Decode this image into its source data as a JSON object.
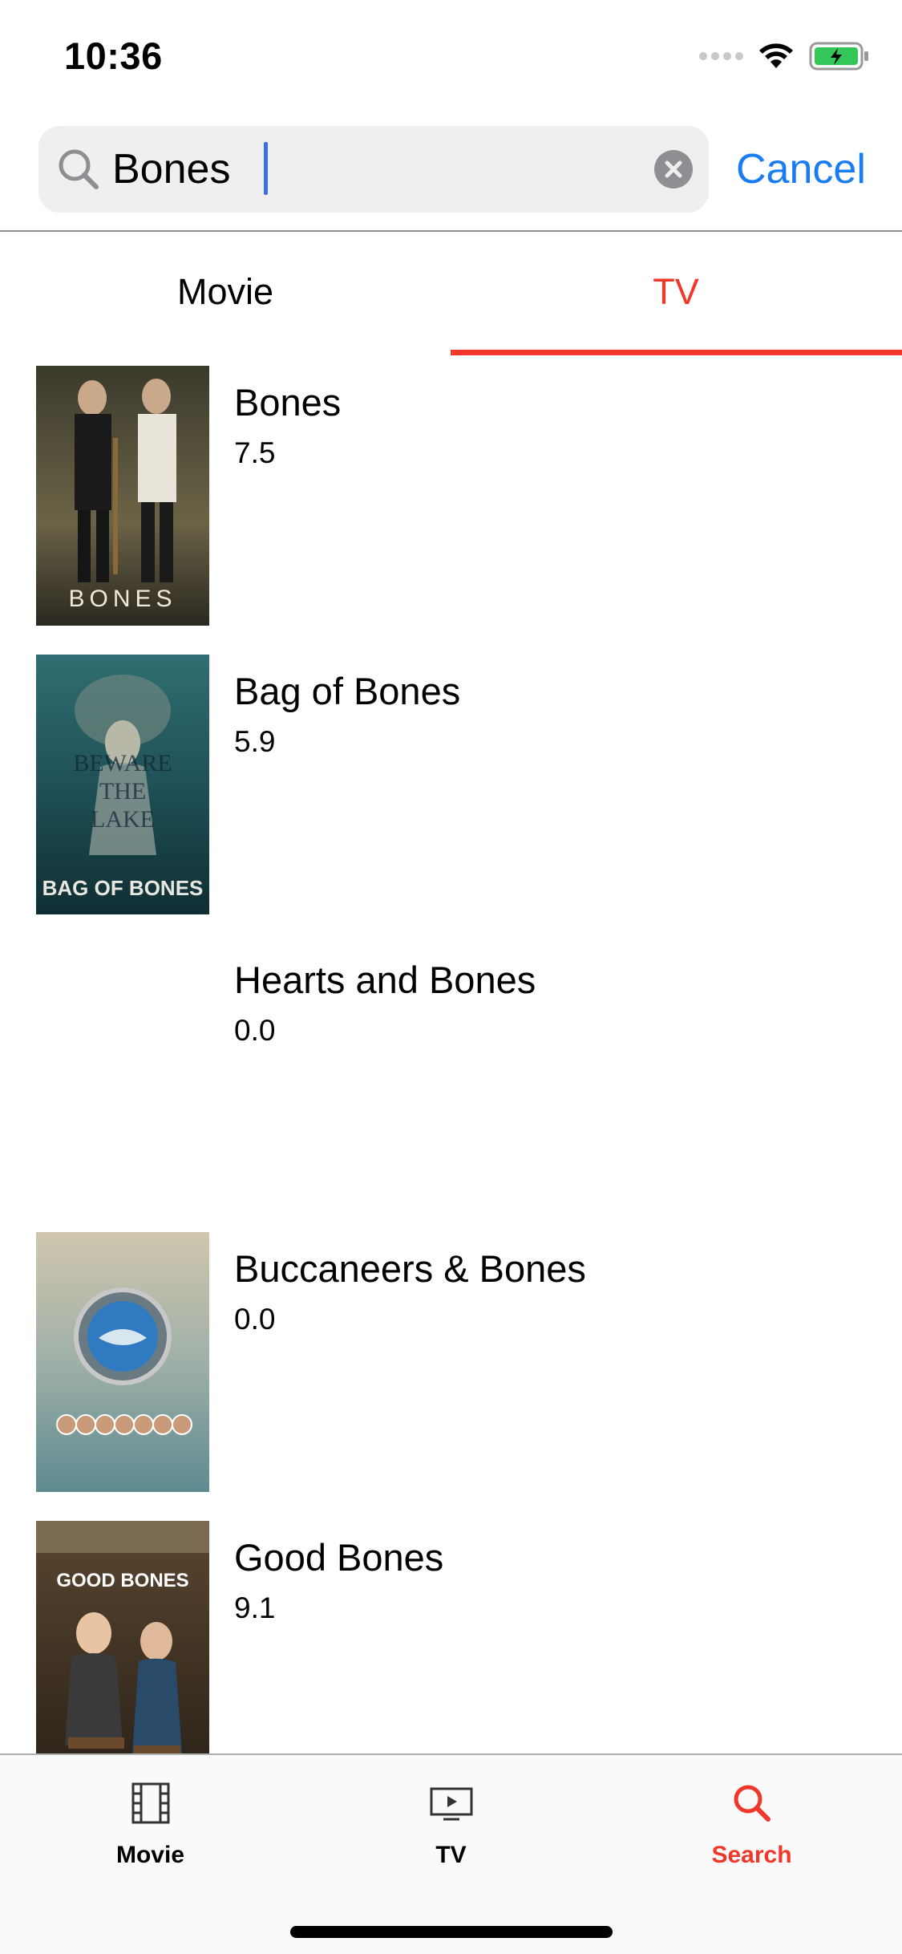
{
  "status_bar": {
    "time": "10:36"
  },
  "search": {
    "value": "Bones",
    "cancel_label": "Cancel"
  },
  "segment_tabs": [
    {
      "label": "Movie",
      "selected": false
    },
    {
      "label": "TV",
      "selected": true
    }
  ],
  "results": [
    {
      "title": "Bones",
      "rating": "7.5",
      "poster_text": "BONES",
      "has_poster": true
    },
    {
      "title": "Bag of Bones",
      "rating": "5.9",
      "poster_text": "BAG OF BONES",
      "has_poster": true
    },
    {
      "title": "Hearts and Bones",
      "rating": "0.0",
      "has_poster": false
    },
    {
      "title": "Buccaneers & Bones",
      "rating": "0.0",
      "has_poster": true
    },
    {
      "title": "Good Bones",
      "rating": "9.1",
      "poster_text": "GOOD BONES",
      "has_poster": true
    }
  ],
  "tab_bar": {
    "items": [
      {
        "label": "Movie",
        "icon": "film-icon",
        "active": false
      },
      {
        "label": "TV",
        "icon": "tv-icon",
        "active": false
      },
      {
        "label": "Search",
        "icon": "search-icon",
        "active": true
      }
    ]
  },
  "colors": {
    "accent_red": "#f1362a",
    "link_blue": "#1a7cf2",
    "inactive_tab": "#000000"
  }
}
